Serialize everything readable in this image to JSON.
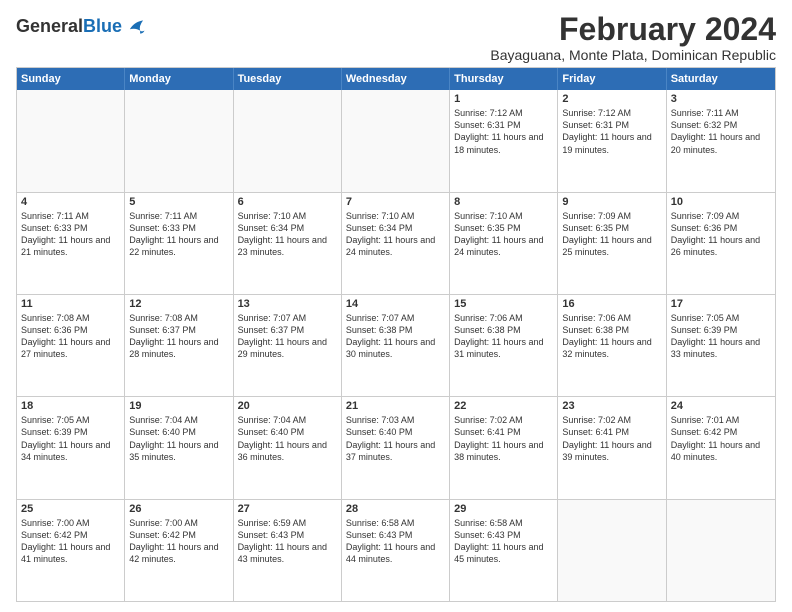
{
  "logo": {
    "general": "General",
    "blue": "Blue"
  },
  "title": "February 2024",
  "location": "Bayaguana, Monte Plata, Dominican Republic",
  "header_days": [
    "Sunday",
    "Monday",
    "Tuesday",
    "Wednesday",
    "Thursday",
    "Friday",
    "Saturday"
  ],
  "weeks": [
    [
      {
        "day": "",
        "info": ""
      },
      {
        "day": "",
        "info": ""
      },
      {
        "day": "",
        "info": ""
      },
      {
        "day": "",
        "info": ""
      },
      {
        "day": "1",
        "info": "Sunrise: 7:12 AM\nSunset: 6:31 PM\nDaylight: 11 hours and 18 minutes."
      },
      {
        "day": "2",
        "info": "Sunrise: 7:12 AM\nSunset: 6:31 PM\nDaylight: 11 hours and 19 minutes."
      },
      {
        "day": "3",
        "info": "Sunrise: 7:11 AM\nSunset: 6:32 PM\nDaylight: 11 hours and 20 minutes."
      }
    ],
    [
      {
        "day": "4",
        "info": "Sunrise: 7:11 AM\nSunset: 6:33 PM\nDaylight: 11 hours and 21 minutes."
      },
      {
        "day": "5",
        "info": "Sunrise: 7:11 AM\nSunset: 6:33 PM\nDaylight: 11 hours and 22 minutes."
      },
      {
        "day": "6",
        "info": "Sunrise: 7:10 AM\nSunset: 6:34 PM\nDaylight: 11 hours and 23 minutes."
      },
      {
        "day": "7",
        "info": "Sunrise: 7:10 AM\nSunset: 6:34 PM\nDaylight: 11 hours and 24 minutes."
      },
      {
        "day": "8",
        "info": "Sunrise: 7:10 AM\nSunset: 6:35 PM\nDaylight: 11 hours and 24 minutes."
      },
      {
        "day": "9",
        "info": "Sunrise: 7:09 AM\nSunset: 6:35 PM\nDaylight: 11 hours and 25 minutes."
      },
      {
        "day": "10",
        "info": "Sunrise: 7:09 AM\nSunset: 6:36 PM\nDaylight: 11 hours and 26 minutes."
      }
    ],
    [
      {
        "day": "11",
        "info": "Sunrise: 7:08 AM\nSunset: 6:36 PM\nDaylight: 11 hours and 27 minutes."
      },
      {
        "day": "12",
        "info": "Sunrise: 7:08 AM\nSunset: 6:37 PM\nDaylight: 11 hours and 28 minutes."
      },
      {
        "day": "13",
        "info": "Sunrise: 7:07 AM\nSunset: 6:37 PM\nDaylight: 11 hours and 29 minutes."
      },
      {
        "day": "14",
        "info": "Sunrise: 7:07 AM\nSunset: 6:38 PM\nDaylight: 11 hours and 30 minutes."
      },
      {
        "day": "15",
        "info": "Sunrise: 7:06 AM\nSunset: 6:38 PM\nDaylight: 11 hours and 31 minutes."
      },
      {
        "day": "16",
        "info": "Sunrise: 7:06 AM\nSunset: 6:38 PM\nDaylight: 11 hours and 32 minutes."
      },
      {
        "day": "17",
        "info": "Sunrise: 7:05 AM\nSunset: 6:39 PM\nDaylight: 11 hours and 33 minutes."
      }
    ],
    [
      {
        "day": "18",
        "info": "Sunrise: 7:05 AM\nSunset: 6:39 PM\nDaylight: 11 hours and 34 minutes."
      },
      {
        "day": "19",
        "info": "Sunrise: 7:04 AM\nSunset: 6:40 PM\nDaylight: 11 hours and 35 minutes."
      },
      {
        "day": "20",
        "info": "Sunrise: 7:04 AM\nSunset: 6:40 PM\nDaylight: 11 hours and 36 minutes."
      },
      {
        "day": "21",
        "info": "Sunrise: 7:03 AM\nSunset: 6:40 PM\nDaylight: 11 hours and 37 minutes."
      },
      {
        "day": "22",
        "info": "Sunrise: 7:02 AM\nSunset: 6:41 PM\nDaylight: 11 hours and 38 minutes."
      },
      {
        "day": "23",
        "info": "Sunrise: 7:02 AM\nSunset: 6:41 PM\nDaylight: 11 hours and 39 minutes."
      },
      {
        "day": "24",
        "info": "Sunrise: 7:01 AM\nSunset: 6:42 PM\nDaylight: 11 hours and 40 minutes."
      }
    ],
    [
      {
        "day": "25",
        "info": "Sunrise: 7:00 AM\nSunset: 6:42 PM\nDaylight: 11 hours and 41 minutes."
      },
      {
        "day": "26",
        "info": "Sunrise: 7:00 AM\nSunset: 6:42 PM\nDaylight: 11 hours and 42 minutes."
      },
      {
        "day": "27",
        "info": "Sunrise: 6:59 AM\nSunset: 6:43 PM\nDaylight: 11 hours and 43 minutes."
      },
      {
        "day": "28",
        "info": "Sunrise: 6:58 AM\nSunset: 6:43 PM\nDaylight: 11 hours and 44 minutes."
      },
      {
        "day": "29",
        "info": "Sunrise: 6:58 AM\nSunset: 6:43 PM\nDaylight: 11 hours and 45 minutes."
      },
      {
        "day": "",
        "info": ""
      },
      {
        "day": "",
        "info": ""
      }
    ]
  ]
}
